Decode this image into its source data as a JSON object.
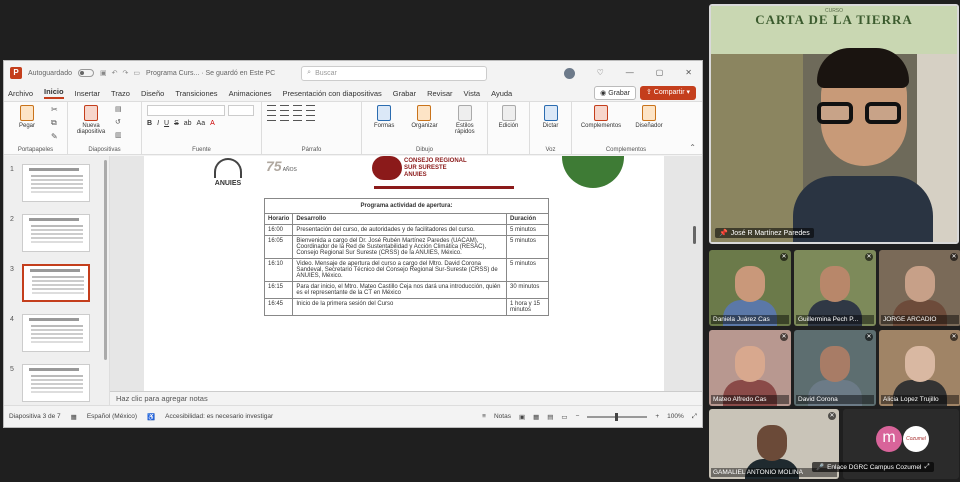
{
  "ppt": {
    "logo": "P",
    "autosave": "Autoguardado",
    "doc_title": "Programa Curs... · Se guardó en Este PC",
    "search_placeholder": "Buscar",
    "tabs": [
      "Archivo",
      "Inicio",
      "Insertar",
      "Trazo",
      "Diseño",
      "Transiciones",
      "Animaciones",
      "Presentación con diapositivas",
      "Grabar",
      "Revisar",
      "Vista",
      "Ayuda"
    ],
    "grabar": "Grabar",
    "compartir": "Compartir",
    "ribbon": {
      "pegar": "Pegar",
      "nueva": "Nueva diapositiva",
      "formas": "Formas",
      "organizar": "Organizar",
      "estilos": "Estilos rápidos",
      "edicion": "Edición",
      "dictar": "Dictar",
      "complementos": "Complementos",
      "disenador": "Diseñador",
      "groups": [
        "Portapapeles",
        "Diapositivas",
        "Fuente",
        "Párrafo",
        "Dibujo",
        "Voz",
        "Complementos"
      ]
    },
    "thumb_numbers": [
      "1",
      "2",
      "3",
      "4",
      "5"
    ],
    "slide": {
      "anuies": "ANUIES",
      "anios": "75",
      "anios_label": "AÑOS",
      "consejo": [
        "CONSEJO REGIONAL",
        "SUR SURESTE",
        "ANUIES"
      ],
      "table_title": "Programa actividad de apertura:",
      "headers": [
        "Horario",
        "Desarrollo",
        "Duración"
      ],
      "rows": [
        {
          "time": "16:00",
          "desc": "Presentación del curso, de autoridades y de facilitadores del curso.",
          "dur": "5 minutos"
        },
        {
          "time": "16:05",
          "desc": "Bienvenida a cargo del Dr. José Rubén Martínez Paredes (UACAM), Coordinador de la Red de Sustentabilidad y Acción Climática (RESAC), Consejo Regional Sur Sureste (CRSS) de la ANUIES, México.",
          "dur": "5 minutos"
        },
        {
          "time": "16:10",
          "desc": "Video. Mensaje de apertura del curso a cargo del Mtro. David Corona Sandeval, Secretario Técnico del Consejo Regional Sur-Sureste (CRSS) de ANUIES, México.",
          "dur": "5 minutos"
        },
        {
          "time": "16:15",
          "desc": "Para dar inicio, el Mtro. Mateo Castillo Ceja nos dará una introducción, quién es el representante de la CT en México",
          "dur": "30 minutos"
        },
        {
          "time": "16:45",
          "desc": "Inicio de la primera sesión del Curso",
          "dur": "1 hora y 15 minutos"
        }
      ]
    },
    "notes_placeholder": "Haz clic para agregar notas",
    "status": {
      "slide": "Diapositiva 3 de 7",
      "lang": "Español (México)",
      "access": "Accesibilidad: es necesario investigar",
      "notas": "Notas",
      "zoom": "100%"
    }
  },
  "meeting": {
    "banner_sub": "CURSO",
    "banner_title": "CARTA DE LA TIERRA",
    "speaker_name": "José R Martínez Paredes",
    "participants": [
      {
        "name": "Daniela Juárez Cas",
        "skin": "#c9987a",
        "body": "#5b78a8",
        "bg": "#6b7a4a"
      },
      {
        "name": "Guillermina Pech P...",
        "skin": "#b8876a",
        "body": "#303845",
        "bg": "#7d8a5a"
      },
      {
        "name": "JORGE ARCADIO",
        "skin": "#c7a088",
        "body": "#6d4b3a",
        "bg": "#7a6a58"
      },
      {
        "name": "Mateo Alfredo Cas",
        "skin": "#d8a88e",
        "body": "#8a4a48",
        "bg": "#b89890"
      },
      {
        "name": "David Corona",
        "skin": "#a87c66",
        "body": "#6c7b87",
        "bg": "#5d6e70"
      },
      {
        "name": "Alicia Lopez Trujillo",
        "skin": "#d9b8a2",
        "body": "#333",
        "bg": "#a08466"
      },
      {
        "name": "GAMALIEL ANTONIO MOLINA",
        "skin": "#6b4a38",
        "body": "#1f2a2f",
        "bg": "#c9c4b8"
      }
    ],
    "m_letter": "m",
    "m_logo": "Cozumel",
    "enlace": "Enlace DGRC Campus Cozumel"
  }
}
